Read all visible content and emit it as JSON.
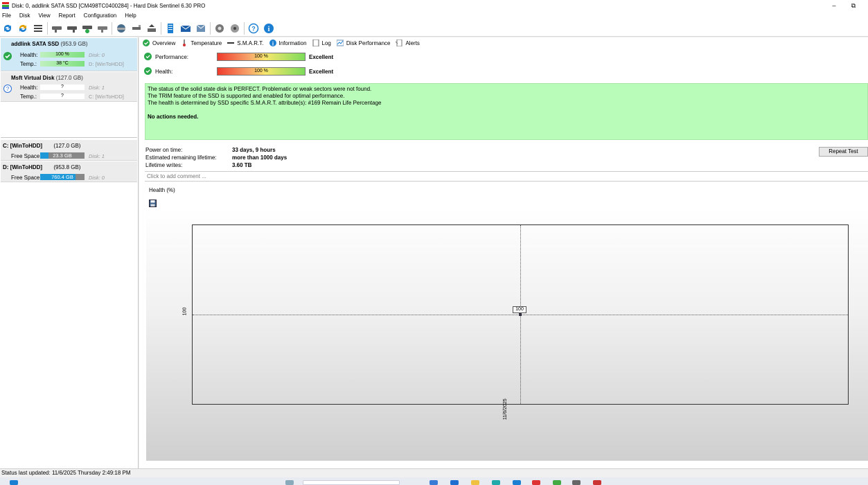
{
  "window": {
    "title": "Disk: 0, addlink SATA SSD [CM498TC0400284]  -  Hard Disk Sentinel 6.30 PRO",
    "min_symbol": "–",
    "restore_symbol": "⧉"
  },
  "menu": [
    "File",
    "Disk",
    "View",
    "Report",
    "Configuration",
    "Help"
  ],
  "toolbar": {
    "icons": [
      "refresh-icon",
      "refresh-all-icon",
      "list-icon",
      "disk-icon",
      "disk-remove-icon",
      "disk-check-icon",
      "disk-icon",
      "surface-test-icon",
      "disk-tool-icon",
      "disk-export-icon",
      "report-icon",
      "email-icon",
      "send-icon",
      "settings-icon",
      "options-icon",
      "help-icon",
      "info-icon"
    ]
  },
  "disks": [
    {
      "name": "addlink SATA SSD",
      "size": "(953.9 GB)",
      "health_label": "Health:",
      "health": "100 %",
      "temp_label": "Temp.:",
      "temp": "38 °C",
      "note1": "Disk: 0",
      "note2": "D: [WinToHDD]",
      "status_color": "#2aa84a"
    },
    {
      "name": "Msft   Virtual Disk",
      "size": "(127.0 GB)",
      "health_label": "Health:",
      "health": "?",
      "temp_label": "Temp.:",
      "temp": "?",
      "note1": "Disk: 1",
      "note2": "C: [WinToHDD]",
      "status_color": "#2f6fd6"
    }
  ],
  "volumes": [
    {
      "name": "C: [WinToHDD]",
      "size": "(127.0 GB)",
      "free_label": "Free Space",
      "free": "23.3 GB",
      "free_fraction": 0.18,
      "disk": "Disk: 1"
    },
    {
      "name": "D: [WinToHDD]",
      "size": "(953.8 GB)",
      "free_label": "Free Space",
      "free": "760.4 GB",
      "free_fraction": 0.8,
      "disk": "Disk: 0"
    }
  ],
  "tabs": [
    {
      "label": "Overview",
      "icon": "check-icon"
    },
    {
      "label": "Temperature",
      "icon": "thermometer-icon"
    },
    {
      "label": "S.M.A.R.T.",
      "icon": "dash-icon"
    },
    {
      "label": "Information",
      "icon": "info-icon"
    },
    {
      "label": "Log",
      "icon": "log-icon"
    },
    {
      "label": "Disk Performance",
      "icon": "chart-icon"
    },
    {
      "label": "Alerts",
      "icon": "alert-icon"
    }
  ],
  "performance": {
    "label": "Performance:",
    "value": "100 %",
    "rating": "Excellent"
  },
  "health": {
    "label": "Health:",
    "value": "100 %",
    "rating": "Excellent"
  },
  "status_message": {
    "line1": "The status of the solid state disk is PERFECT. Problematic or weak sectors were not found.",
    "line2": "The TRIM feature of the SSD is supported and enabled for optimal performance.",
    "line3": "The health is determined by SSD specific S.M.A.R.T. attribute(s):  #169 Remain Life Percentage",
    "action": "No actions needed."
  },
  "details": {
    "power_on_label": "Power on time:",
    "power_on": "33 days, 9 hours",
    "remaining_label": "Estimated remaining lifetime:",
    "remaining": "more than 1000 days",
    "writes_label": "Lifetime writes:",
    "writes": "3.60 TB"
  },
  "repeat_test": "Repeat Test",
  "comment_placeholder": "Click to add comment ...",
  "graph": {
    "tab": "Health (%)"
  },
  "chart_data": {
    "type": "line",
    "title": "",
    "xlabel": "",
    "ylabel": "",
    "categories": [
      "11/6/2025"
    ],
    "series": [
      {
        "values": [
          100
        ]
      }
    ],
    "point_label": "100",
    "y_tick": "100"
  },
  "statusbar": "Status last updated: 11/6/2025 Thursday 2:49:18 PM"
}
